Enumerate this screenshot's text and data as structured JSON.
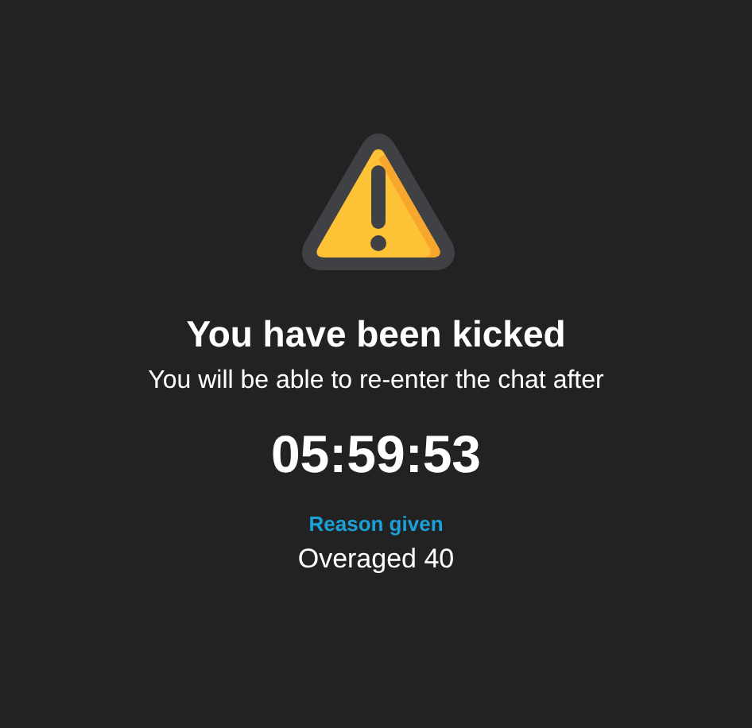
{
  "title": "You have been kicked",
  "message": "You will be able to re-enter the chat after",
  "countdown": "05:59:53",
  "reason": {
    "label": "Reason given",
    "value": "Overaged 40"
  }
}
